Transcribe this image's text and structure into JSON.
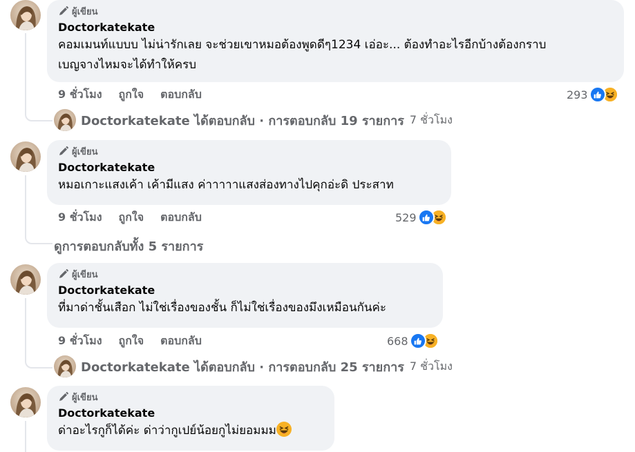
{
  "author_badge_label": "ผู้เขียน",
  "comments": [
    {
      "author": "Doctorkatekate",
      "text": "คอมเมนท์แบบบ ไม่น่ารักเลย จะช่วยเขาหมอต้องพูดดีๆ1234 เอ่อะ... ต้องทำอะไรอีกบ้างต้องกราบ\nเบญจางไหมจะได้ทำให้ครบ",
      "time": "9 ชั่วโมง",
      "like_label": "ถูกใจ",
      "reply_label": "ตอบกลับ",
      "reaction_count": "293",
      "reply_summary": {
        "text": "Doctorkatekate ได้ตอบกลับ · การตอบกลับ 19 รายการ",
        "time": "7 ชั่วโมง"
      }
    },
    {
      "author": "Doctorkatekate",
      "text": "หมอเกาะแสงเค้า เค้ามีแสง ค่าาาาาแสงส่องทางไปคุกอ่ะดิ ประสาท",
      "time": "9 ชั่วโมง",
      "like_label": "ถูกใจ",
      "reply_label": "ตอบกลับ",
      "reaction_count": "529",
      "view_replies": "ดูการตอบกลับทั้ง 5 รายการ"
    },
    {
      "author": "Doctorkatekate",
      "text": "ที่มาด่าชั้นเสือก ไม่ใช่เรื่องของชั้น ก็ไม่ใช่เรื่องของมึงเหมือนกันค่ะ",
      "time": "9 ชั่วโมง",
      "like_label": "ถูกใจ",
      "reply_label": "ตอบกลับ",
      "reaction_count": "668",
      "reply_summary": {
        "text": "Doctorkatekate ได้ตอบกลับ · การตอบกลับ 25 รายการ",
        "time": "7 ชั่วโมง"
      }
    },
    {
      "author": "Doctorkatekate",
      "text": "ด่าอะไรกูก็ได้ค่ะ ด่าว่ากูเปย์น้อยกูไม่ยอมมม"
    }
  ],
  "colors": {
    "bubble": "#f0f2f5",
    "secondary_text": "#65676b",
    "like_blue": "#1877f2",
    "haha_yellow": "#f7b125"
  },
  "icons": {
    "author_badge": "pencil-icon",
    "like": "thumbs-up-icon",
    "haha": "laughing-face-icon"
  }
}
